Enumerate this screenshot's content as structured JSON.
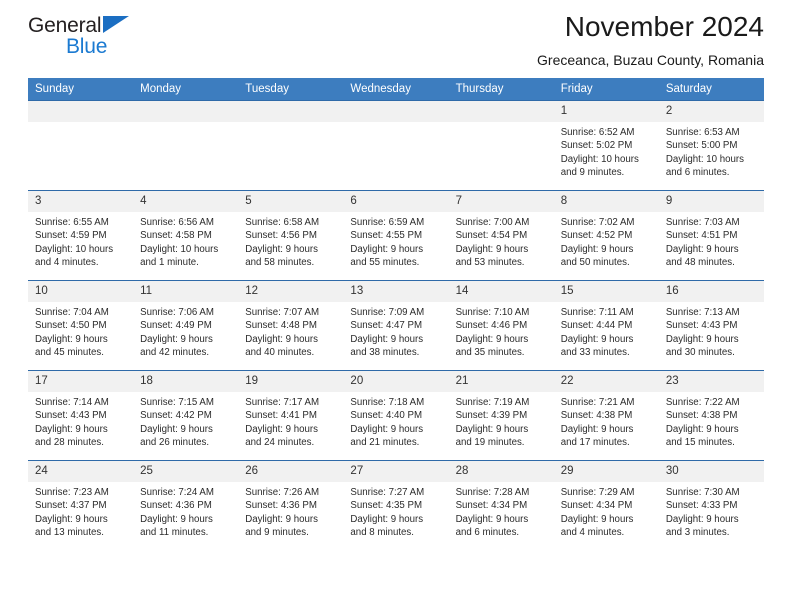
{
  "brand": {
    "line1": "General",
    "line2": "Blue",
    "triangle_color": "#1b6ec2",
    "line2_color": "#1b7ad1"
  },
  "header": {
    "title": "November 2024",
    "subtitle": "Greceanca, Buzau County, Romania"
  },
  "colors": {
    "header_band": "#3d7dbf",
    "row_divider": "#2f6aa8",
    "daynum_band": "#f1f1f1"
  },
  "weekdays": [
    "Sunday",
    "Monday",
    "Tuesday",
    "Wednesday",
    "Thursday",
    "Friday",
    "Saturday"
  ],
  "labels": {
    "sunrise_prefix": "Sunrise:",
    "sunset_prefix": "Sunset:",
    "daylight_prefix": "Daylight:"
  },
  "weeks": [
    [
      {
        "day": "",
        "empty": true
      },
      {
        "day": "",
        "empty": true
      },
      {
        "day": "",
        "empty": true
      },
      {
        "day": "",
        "empty": true
      },
      {
        "day": "",
        "empty": true
      },
      {
        "day": "1",
        "sunrise": "Sunrise: 6:52 AM",
        "sunset": "Sunset: 5:02 PM",
        "daylight1": "Daylight: 10 hours",
        "daylight2": "and 9 minutes."
      },
      {
        "day": "2",
        "sunrise": "Sunrise: 6:53 AM",
        "sunset": "Sunset: 5:00 PM",
        "daylight1": "Daylight: 10 hours",
        "daylight2": "and 6 minutes."
      }
    ],
    [
      {
        "day": "3",
        "sunrise": "Sunrise: 6:55 AM",
        "sunset": "Sunset: 4:59 PM",
        "daylight1": "Daylight: 10 hours",
        "daylight2": "and 4 minutes."
      },
      {
        "day": "4",
        "sunrise": "Sunrise: 6:56 AM",
        "sunset": "Sunset: 4:58 PM",
        "daylight1": "Daylight: 10 hours",
        "daylight2": "and 1 minute."
      },
      {
        "day": "5",
        "sunrise": "Sunrise: 6:58 AM",
        "sunset": "Sunset: 4:56 PM",
        "daylight1": "Daylight: 9 hours",
        "daylight2": "and 58 minutes."
      },
      {
        "day": "6",
        "sunrise": "Sunrise: 6:59 AM",
        "sunset": "Sunset: 4:55 PM",
        "daylight1": "Daylight: 9 hours",
        "daylight2": "and 55 minutes."
      },
      {
        "day": "7",
        "sunrise": "Sunrise: 7:00 AM",
        "sunset": "Sunset: 4:54 PM",
        "daylight1": "Daylight: 9 hours",
        "daylight2": "and 53 minutes."
      },
      {
        "day": "8",
        "sunrise": "Sunrise: 7:02 AM",
        "sunset": "Sunset: 4:52 PM",
        "daylight1": "Daylight: 9 hours",
        "daylight2": "and 50 minutes."
      },
      {
        "day": "9",
        "sunrise": "Sunrise: 7:03 AM",
        "sunset": "Sunset: 4:51 PM",
        "daylight1": "Daylight: 9 hours",
        "daylight2": "and 48 minutes."
      }
    ],
    [
      {
        "day": "10",
        "sunrise": "Sunrise: 7:04 AM",
        "sunset": "Sunset: 4:50 PM",
        "daylight1": "Daylight: 9 hours",
        "daylight2": "and 45 minutes."
      },
      {
        "day": "11",
        "sunrise": "Sunrise: 7:06 AM",
        "sunset": "Sunset: 4:49 PM",
        "daylight1": "Daylight: 9 hours",
        "daylight2": "and 42 minutes."
      },
      {
        "day": "12",
        "sunrise": "Sunrise: 7:07 AM",
        "sunset": "Sunset: 4:48 PM",
        "daylight1": "Daylight: 9 hours",
        "daylight2": "and 40 minutes."
      },
      {
        "day": "13",
        "sunrise": "Sunrise: 7:09 AM",
        "sunset": "Sunset: 4:47 PM",
        "daylight1": "Daylight: 9 hours",
        "daylight2": "and 38 minutes."
      },
      {
        "day": "14",
        "sunrise": "Sunrise: 7:10 AM",
        "sunset": "Sunset: 4:46 PM",
        "daylight1": "Daylight: 9 hours",
        "daylight2": "and 35 minutes."
      },
      {
        "day": "15",
        "sunrise": "Sunrise: 7:11 AM",
        "sunset": "Sunset: 4:44 PM",
        "daylight1": "Daylight: 9 hours",
        "daylight2": "and 33 minutes."
      },
      {
        "day": "16",
        "sunrise": "Sunrise: 7:13 AM",
        "sunset": "Sunset: 4:43 PM",
        "daylight1": "Daylight: 9 hours",
        "daylight2": "and 30 minutes."
      }
    ],
    [
      {
        "day": "17",
        "sunrise": "Sunrise: 7:14 AM",
        "sunset": "Sunset: 4:43 PM",
        "daylight1": "Daylight: 9 hours",
        "daylight2": "and 28 minutes."
      },
      {
        "day": "18",
        "sunrise": "Sunrise: 7:15 AM",
        "sunset": "Sunset: 4:42 PM",
        "daylight1": "Daylight: 9 hours",
        "daylight2": "and 26 minutes."
      },
      {
        "day": "19",
        "sunrise": "Sunrise: 7:17 AM",
        "sunset": "Sunset: 4:41 PM",
        "daylight1": "Daylight: 9 hours",
        "daylight2": "and 24 minutes."
      },
      {
        "day": "20",
        "sunrise": "Sunrise: 7:18 AM",
        "sunset": "Sunset: 4:40 PM",
        "daylight1": "Daylight: 9 hours",
        "daylight2": "and 21 minutes."
      },
      {
        "day": "21",
        "sunrise": "Sunrise: 7:19 AM",
        "sunset": "Sunset: 4:39 PM",
        "daylight1": "Daylight: 9 hours",
        "daylight2": "and 19 minutes."
      },
      {
        "day": "22",
        "sunrise": "Sunrise: 7:21 AM",
        "sunset": "Sunset: 4:38 PM",
        "daylight1": "Daylight: 9 hours",
        "daylight2": "and 17 minutes."
      },
      {
        "day": "23",
        "sunrise": "Sunrise: 7:22 AM",
        "sunset": "Sunset: 4:38 PM",
        "daylight1": "Daylight: 9 hours",
        "daylight2": "and 15 minutes."
      }
    ],
    [
      {
        "day": "24",
        "sunrise": "Sunrise: 7:23 AM",
        "sunset": "Sunset: 4:37 PM",
        "daylight1": "Daylight: 9 hours",
        "daylight2": "and 13 minutes."
      },
      {
        "day": "25",
        "sunrise": "Sunrise: 7:24 AM",
        "sunset": "Sunset: 4:36 PM",
        "daylight1": "Daylight: 9 hours",
        "daylight2": "and 11 minutes."
      },
      {
        "day": "26",
        "sunrise": "Sunrise: 7:26 AM",
        "sunset": "Sunset: 4:36 PM",
        "daylight1": "Daylight: 9 hours",
        "daylight2": "and 9 minutes."
      },
      {
        "day": "27",
        "sunrise": "Sunrise: 7:27 AM",
        "sunset": "Sunset: 4:35 PM",
        "daylight1": "Daylight: 9 hours",
        "daylight2": "and 8 minutes."
      },
      {
        "day": "28",
        "sunrise": "Sunrise: 7:28 AM",
        "sunset": "Sunset: 4:34 PM",
        "daylight1": "Daylight: 9 hours",
        "daylight2": "and 6 minutes."
      },
      {
        "day": "29",
        "sunrise": "Sunrise: 7:29 AM",
        "sunset": "Sunset: 4:34 PM",
        "daylight1": "Daylight: 9 hours",
        "daylight2": "and 4 minutes."
      },
      {
        "day": "30",
        "sunrise": "Sunrise: 7:30 AM",
        "sunset": "Sunset: 4:33 PM",
        "daylight1": "Daylight: 9 hours",
        "daylight2": "and 3 minutes."
      }
    ]
  ]
}
